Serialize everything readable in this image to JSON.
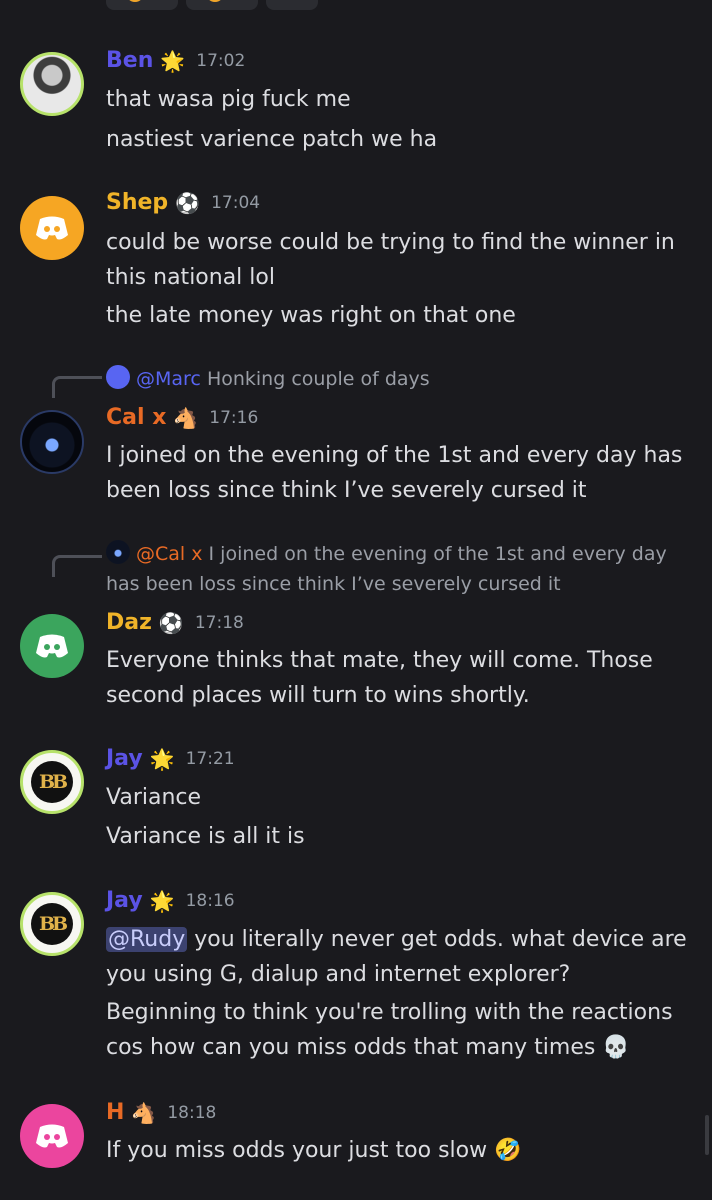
{
  "colors": {
    "background": "#1a1a1e",
    "text": "#dcdde1",
    "timestamp": "#949ba4",
    "mention_bg": "#3c4270",
    "purple_name": "#5b53e6",
    "gold_name": "#f0b429",
    "orange_name": "#e86a25"
  },
  "messages": [
    {
      "author": "Ben",
      "badge_icon": "sparkle-icon",
      "time": "17:02",
      "name_color": "#5b53e6",
      "lines": [
        "that wasa pig fuck me",
        "nastiest varience patch we ha"
      ]
    },
    {
      "author": "Shep",
      "badge_icon": "soccer-ball-icon",
      "time": "17:04",
      "name_color": "#f0b429",
      "lines": [
        "could be worse could be trying to find the winner in this national lol",
        "the late money was right on that one"
      ]
    },
    {
      "author": "Cal x",
      "badge_icon": "horse-icon",
      "time": "17:16",
      "name_color": "#e86a25",
      "reply": {
        "to": "@Marc",
        "text": "Honking couple of days"
      },
      "lines": [
        "I joined on the evening of the 1st and every day has been loss since think I’ve severely cursed it"
      ]
    },
    {
      "author": "Daz",
      "badge_icon": "soccer-ball-icon",
      "time": "17:18",
      "name_color": "#f0b429",
      "reply": {
        "to": "@Cal x",
        "text": "I joined on the evening of the 1st and every day has been loss since think I’ve severely cursed it"
      },
      "lines": [
        "Everyone thinks that mate, they will come. Those second places will turn to wins shortly."
      ]
    },
    {
      "author": "Jay",
      "badge_icon": "sparkle-icon",
      "time": "17:21",
      "name_color": "#5b53e6",
      "lines": [
        "Variance",
        "Variance is all it is"
      ]
    },
    {
      "author": "Jay",
      "badge_icon": "sparkle-icon",
      "time": "18:16",
      "name_color": "#5b53e6",
      "mention": "@Rudy",
      "lines": [
        " you literally never get odds. what device are you using G, dialup and internet explorer?",
        "Beginning to think you're trolling with the reactions cos how can you miss odds that many times 💀"
      ]
    },
    {
      "author": "H",
      "badge_icon": "horse-icon",
      "time": "18:18",
      "name_color": "#e86a25",
      "lines": [
        "If you miss odds your just too slow 🤣"
      ]
    }
  ],
  "avatars": {
    "bb_monogram": "BB"
  }
}
